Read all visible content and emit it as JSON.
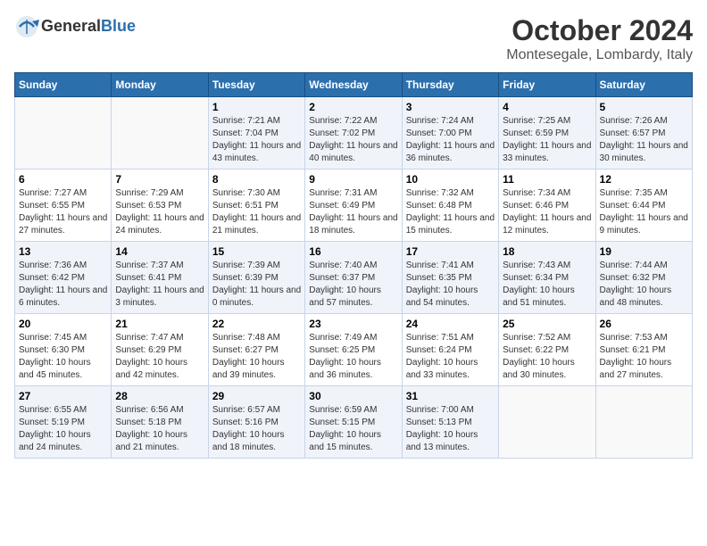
{
  "header": {
    "logo_general": "General",
    "logo_blue": "Blue",
    "month": "October 2024",
    "location": "Montesegale, Lombardy, Italy"
  },
  "days_of_week": [
    "Sunday",
    "Monday",
    "Tuesday",
    "Wednesday",
    "Thursday",
    "Friday",
    "Saturday"
  ],
  "weeks": [
    [
      {
        "day": "",
        "info": ""
      },
      {
        "day": "",
        "info": ""
      },
      {
        "day": "1",
        "info": "Sunrise: 7:21 AM\nSunset: 7:04 PM\nDaylight: 11 hours and 43 minutes."
      },
      {
        "day": "2",
        "info": "Sunrise: 7:22 AM\nSunset: 7:02 PM\nDaylight: 11 hours and 40 minutes."
      },
      {
        "day": "3",
        "info": "Sunrise: 7:24 AM\nSunset: 7:00 PM\nDaylight: 11 hours and 36 minutes."
      },
      {
        "day": "4",
        "info": "Sunrise: 7:25 AM\nSunset: 6:59 PM\nDaylight: 11 hours and 33 minutes."
      },
      {
        "day": "5",
        "info": "Sunrise: 7:26 AM\nSunset: 6:57 PM\nDaylight: 11 hours and 30 minutes."
      }
    ],
    [
      {
        "day": "6",
        "info": "Sunrise: 7:27 AM\nSunset: 6:55 PM\nDaylight: 11 hours and 27 minutes."
      },
      {
        "day": "7",
        "info": "Sunrise: 7:29 AM\nSunset: 6:53 PM\nDaylight: 11 hours and 24 minutes."
      },
      {
        "day": "8",
        "info": "Sunrise: 7:30 AM\nSunset: 6:51 PM\nDaylight: 11 hours and 21 minutes."
      },
      {
        "day": "9",
        "info": "Sunrise: 7:31 AM\nSunset: 6:49 PM\nDaylight: 11 hours and 18 minutes."
      },
      {
        "day": "10",
        "info": "Sunrise: 7:32 AM\nSunset: 6:48 PM\nDaylight: 11 hours and 15 minutes."
      },
      {
        "day": "11",
        "info": "Sunrise: 7:34 AM\nSunset: 6:46 PM\nDaylight: 11 hours and 12 minutes."
      },
      {
        "day": "12",
        "info": "Sunrise: 7:35 AM\nSunset: 6:44 PM\nDaylight: 11 hours and 9 minutes."
      }
    ],
    [
      {
        "day": "13",
        "info": "Sunrise: 7:36 AM\nSunset: 6:42 PM\nDaylight: 11 hours and 6 minutes."
      },
      {
        "day": "14",
        "info": "Sunrise: 7:37 AM\nSunset: 6:41 PM\nDaylight: 11 hours and 3 minutes."
      },
      {
        "day": "15",
        "info": "Sunrise: 7:39 AM\nSunset: 6:39 PM\nDaylight: 11 hours and 0 minutes."
      },
      {
        "day": "16",
        "info": "Sunrise: 7:40 AM\nSunset: 6:37 PM\nDaylight: 10 hours and 57 minutes."
      },
      {
        "day": "17",
        "info": "Sunrise: 7:41 AM\nSunset: 6:35 PM\nDaylight: 10 hours and 54 minutes."
      },
      {
        "day": "18",
        "info": "Sunrise: 7:43 AM\nSunset: 6:34 PM\nDaylight: 10 hours and 51 minutes."
      },
      {
        "day": "19",
        "info": "Sunrise: 7:44 AM\nSunset: 6:32 PM\nDaylight: 10 hours and 48 minutes."
      }
    ],
    [
      {
        "day": "20",
        "info": "Sunrise: 7:45 AM\nSunset: 6:30 PM\nDaylight: 10 hours and 45 minutes."
      },
      {
        "day": "21",
        "info": "Sunrise: 7:47 AM\nSunset: 6:29 PM\nDaylight: 10 hours and 42 minutes."
      },
      {
        "day": "22",
        "info": "Sunrise: 7:48 AM\nSunset: 6:27 PM\nDaylight: 10 hours and 39 minutes."
      },
      {
        "day": "23",
        "info": "Sunrise: 7:49 AM\nSunset: 6:25 PM\nDaylight: 10 hours and 36 minutes."
      },
      {
        "day": "24",
        "info": "Sunrise: 7:51 AM\nSunset: 6:24 PM\nDaylight: 10 hours and 33 minutes."
      },
      {
        "day": "25",
        "info": "Sunrise: 7:52 AM\nSunset: 6:22 PM\nDaylight: 10 hours and 30 minutes."
      },
      {
        "day": "26",
        "info": "Sunrise: 7:53 AM\nSunset: 6:21 PM\nDaylight: 10 hours and 27 minutes."
      }
    ],
    [
      {
        "day": "27",
        "info": "Sunrise: 6:55 AM\nSunset: 5:19 PM\nDaylight: 10 hours and 24 minutes."
      },
      {
        "day": "28",
        "info": "Sunrise: 6:56 AM\nSunset: 5:18 PM\nDaylight: 10 hours and 21 minutes."
      },
      {
        "day": "29",
        "info": "Sunrise: 6:57 AM\nSunset: 5:16 PM\nDaylight: 10 hours and 18 minutes."
      },
      {
        "day": "30",
        "info": "Sunrise: 6:59 AM\nSunset: 5:15 PM\nDaylight: 10 hours and 15 minutes."
      },
      {
        "day": "31",
        "info": "Sunrise: 7:00 AM\nSunset: 5:13 PM\nDaylight: 10 hours and 13 minutes."
      },
      {
        "day": "",
        "info": ""
      },
      {
        "day": "",
        "info": ""
      }
    ]
  ]
}
